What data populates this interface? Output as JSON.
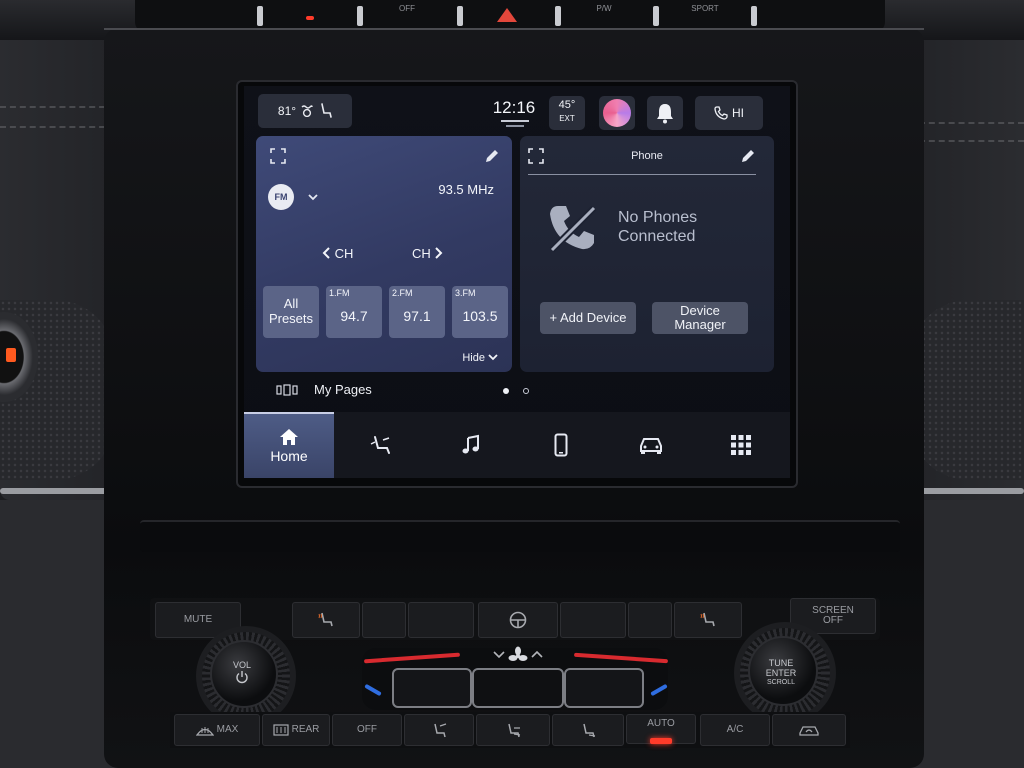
{
  "status_bar": {
    "cabin_temp": "81°",
    "time": "12:16",
    "ext_temp": "45°",
    "ext_label": "EXT",
    "phone_greeting": "HI"
  },
  "radio": {
    "band": "FM",
    "frequency": "93.5 MHz",
    "ch_prev": "CH",
    "ch_next": "CH",
    "all_presets": "All Presets",
    "presets": [
      {
        "num": "1.FM",
        "value": "94.7"
      },
      {
        "num": "2.FM",
        "value": "97.1"
      },
      {
        "num": "3.FM",
        "value": "103.5"
      }
    ],
    "hide_label": "Hide"
  },
  "phone": {
    "title": "Phone",
    "message_line1": "No Phones",
    "message_line2": "Connected",
    "add_device": "+ Add Device",
    "device_manager_line1": "Device",
    "device_manager_line2": "Manager"
  },
  "pages": {
    "label": "My Pages",
    "current": 1,
    "count": 2
  },
  "nav": {
    "items": [
      {
        "label": "Home",
        "icon": "home-icon",
        "active": true
      },
      {
        "label": "",
        "icon": "seat-comfort-icon",
        "active": false
      },
      {
        "label": "",
        "icon": "music-note-icon",
        "active": false
      },
      {
        "label": "",
        "icon": "smartphone-icon",
        "active": false
      },
      {
        "label": "",
        "icon": "car-icon",
        "active": false
      },
      {
        "label": "",
        "icon": "app-grid-icon",
        "active": false
      }
    ]
  },
  "hardware": {
    "mute": "MUTE",
    "vol": "VOL",
    "screen_off_line1": "SCREEN",
    "screen_off_line2": "OFF",
    "tune_line1": "TUNE",
    "tune_line2": "ENTER",
    "tune_line3": "SCROLL",
    "max": "MAX",
    "rear": "REAR",
    "off": "OFF",
    "auto": "AUTO",
    "ac": "A/C",
    "top_strip": [
      "",
      "",
      "OFF",
      "",
      "",
      "P/W",
      "SPORT"
    ]
  },
  "colors": {
    "radio_card": "#3f4a78",
    "preset_bg": "#5b6487",
    "nav_active": "#4e5c86",
    "led_red": "#ff3b2a"
  }
}
